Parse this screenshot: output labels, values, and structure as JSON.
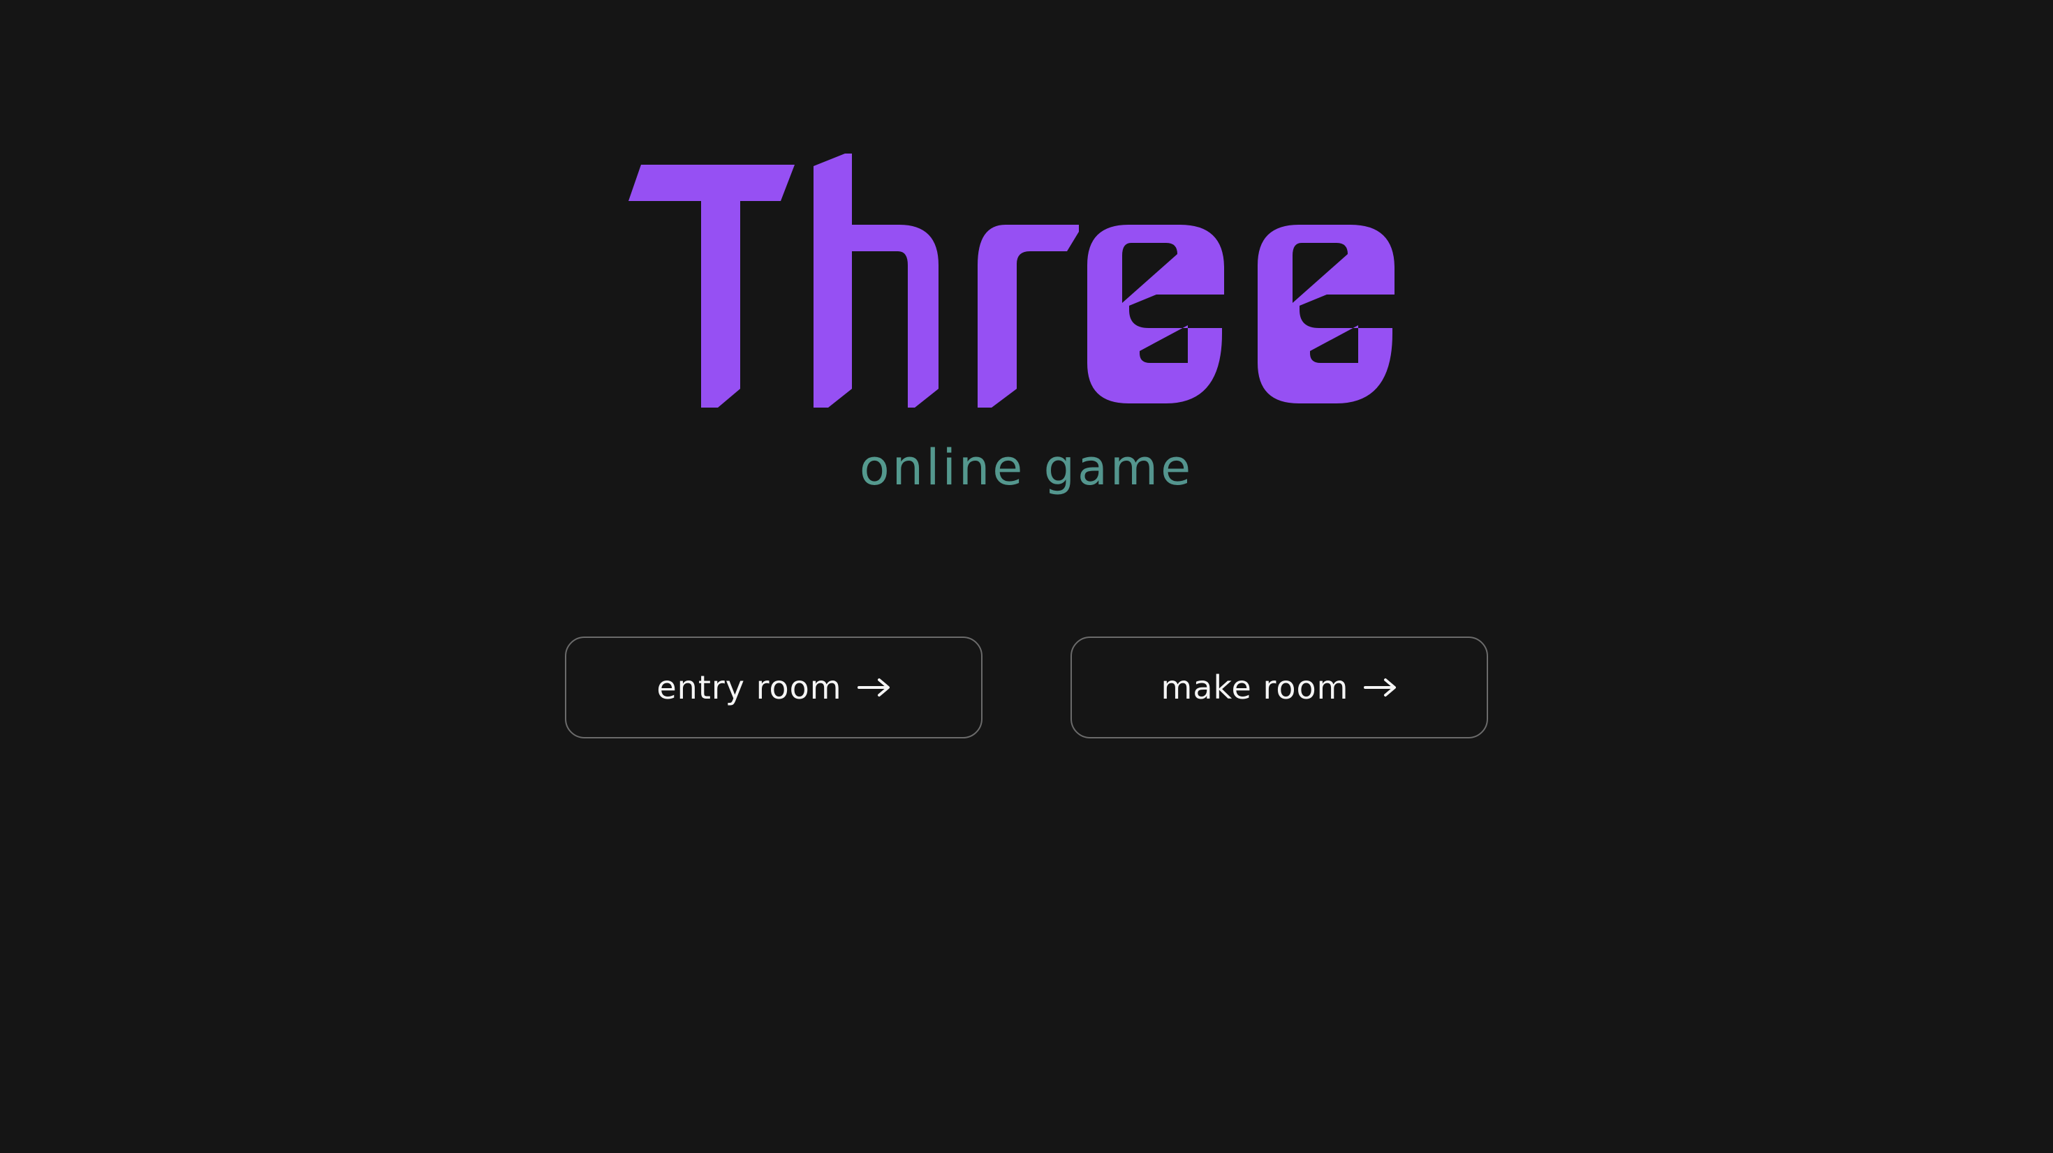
{
  "hero": {
    "title": "Three",
    "subtitle": "online game"
  },
  "actions": {
    "entry_room_label": "entry room",
    "make_room_label": "make room",
    "arrow_icon": "right-arrow-icon"
  },
  "colors": {
    "background": "#151515",
    "title": "#9650F3",
    "subtitle_start": "#58A78D",
    "subtitle_end": "#50878F",
    "button_border": "#6B6B6B",
    "button_text": "#F5F5F5"
  }
}
